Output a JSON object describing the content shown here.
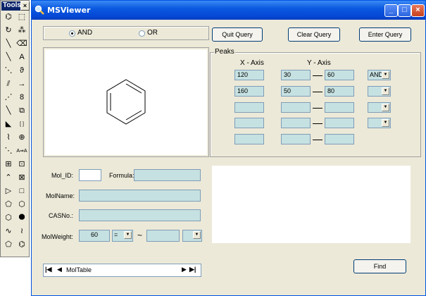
{
  "tools_palette": {
    "title": "Tools",
    "close": "×",
    "items": [
      {
        "name": "lasso-select-icon",
        "glyph": "⌬"
      },
      {
        "name": "rect-select-icon",
        "glyph": "⬚"
      },
      {
        "name": "rotate-icon",
        "glyph": "↻"
      },
      {
        "name": "scatter-icon",
        "glyph": "⁂"
      },
      {
        "name": "pen-icon",
        "glyph": "╲"
      },
      {
        "name": "eraser-icon",
        "glyph": "⌫"
      },
      {
        "name": "single-bond-icon",
        "glyph": "╲"
      },
      {
        "name": "text-tool-icon",
        "glyph": "A"
      },
      {
        "name": "dashed-bond-icon",
        "glyph": "⋱"
      },
      {
        "name": "lasso-icon",
        "glyph": "ϑ"
      },
      {
        "name": "hashed-bond-icon",
        "glyph": "⫽"
      },
      {
        "name": "arrow-icon",
        "glyph": "→"
      },
      {
        "name": "hashed-wedge-icon",
        "glyph": "⋰"
      },
      {
        "name": "chain-icon",
        "glyph": "8"
      },
      {
        "name": "bold-bond-icon",
        "glyph": "╲"
      },
      {
        "name": "box-icon",
        "glyph": "⧉"
      },
      {
        "name": "wedge-bond-icon",
        "glyph": "◣"
      },
      {
        "name": "bracket-icon",
        "glyph": "[ ]"
      },
      {
        "name": "wavy-bond-icon",
        "glyph": "⌇"
      },
      {
        "name": "charge-icon",
        "glyph": "⊕"
      },
      {
        "name": "dotted-bond-icon",
        "glyph": "⋱"
      },
      {
        "name": "atom-map-icon",
        "glyph": "A⇒A"
      },
      {
        "name": "grid-icon",
        "glyph": "⊞"
      },
      {
        "name": "template-icon",
        "glyph": "⊡"
      },
      {
        "name": "chain-bond-icon",
        "glyph": "⌃"
      },
      {
        "name": "orbital-icon",
        "glyph": "⊠"
      },
      {
        "name": "triangle-icon",
        "glyph": "▷"
      },
      {
        "name": "square-icon",
        "glyph": "□"
      },
      {
        "name": "pentagon-icon",
        "glyph": "⬠"
      },
      {
        "name": "hexagon-icon",
        "glyph": "⬡"
      },
      {
        "name": "heptagon-icon",
        "glyph": "⬡"
      },
      {
        "name": "octagon-icon",
        "glyph": "⯃"
      },
      {
        "name": "cyclohexane-chair-icon",
        "glyph": "∿"
      },
      {
        "name": "cyclohexane-boat-icon",
        "glyph": "≀"
      },
      {
        "name": "cyclopentane-icon",
        "glyph": "⬠"
      },
      {
        "name": "benzene-icon",
        "glyph": "⌬"
      }
    ]
  },
  "window": {
    "title": "MSViewer",
    "minimize": "_",
    "maximize": "□",
    "close": "×"
  },
  "logic": {
    "and_label": "AND",
    "or_label": "OR",
    "selected": "AND"
  },
  "buttons": {
    "quit": "Quit Query",
    "clear": "Clear Query",
    "enter": "Enter Query",
    "find": "Find"
  },
  "peaks": {
    "label": "Peaks",
    "x_axis": "X - Axis",
    "y_axis": "Y - Axis",
    "rows": [
      {
        "x": "120",
        "y_min": "30",
        "y_max": "60",
        "op": "AND"
      },
      {
        "x": "160",
        "y_min": "50",
        "y_max": "80",
        "op": ""
      },
      {
        "x": "",
        "y_min": "",
        "y_max": "",
        "op": ""
      },
      {
        "x": "",
        "y_min": "",
        "y_max": "",
        "op": ""
      },
      {
        "x": "",
        "y_min": "",
        "y_max": ""
      }
    ]
  },
  "form": {
    "mol_id_label": "Mol_ID:",
    "mol_id": "",
    "formula_label": "Formula:",
    "formula": "",
    "molname_label": "MolName:",
    "molname": "",
    "casno_label": "CASNo.:",
    "casno": "",
    "molweight_label": "MolWeight:",
    "molweight": "60",
    "molweight_op": "=",
    "tilde": "~",
    "molweight_max": "",
    "molweight_max_op": ""
  },
  "navigator": {
    "label": "MolTable",
    "first": "|◀",
    "prev": "◀",
    "next": "▶",
    "last": "▶|"
  }
}
